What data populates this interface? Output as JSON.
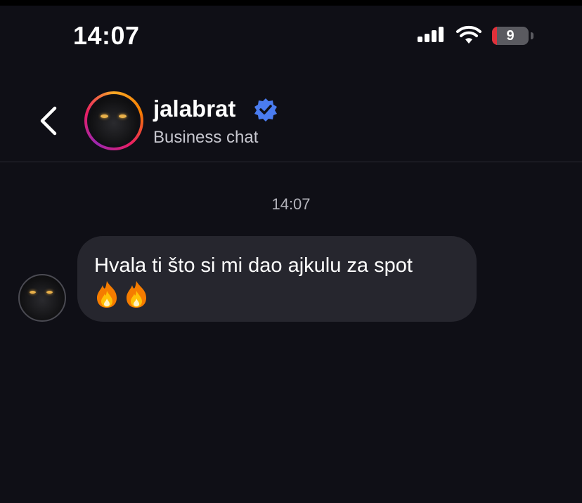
{
  "status_bar": {
    "time": "14:07",
    "battery_level": "9",
    "battery_color": "#e0303a",
    "icons": [
      "signal-icon",
      "wifi-icon",
      "battery-icon"
    ]
  },
  "header": {
    "back_icon": "chevron-left-icon",
    "username": "jalabrat",
    "verified": true,
    "verified_color": "#4a7cf0",
    "subtitle": "Business chat"
  },
  "chat": {
    "timestamp": "14:07",
    "messages": [
      {
        "sender": "jalabrat",
        "text": "Hvala ti što si mi dao ajkulu za spot",
        "emojis": [
          "fire-icon",
          "fire-icon"
        ]
      }
    ]
  }
}
